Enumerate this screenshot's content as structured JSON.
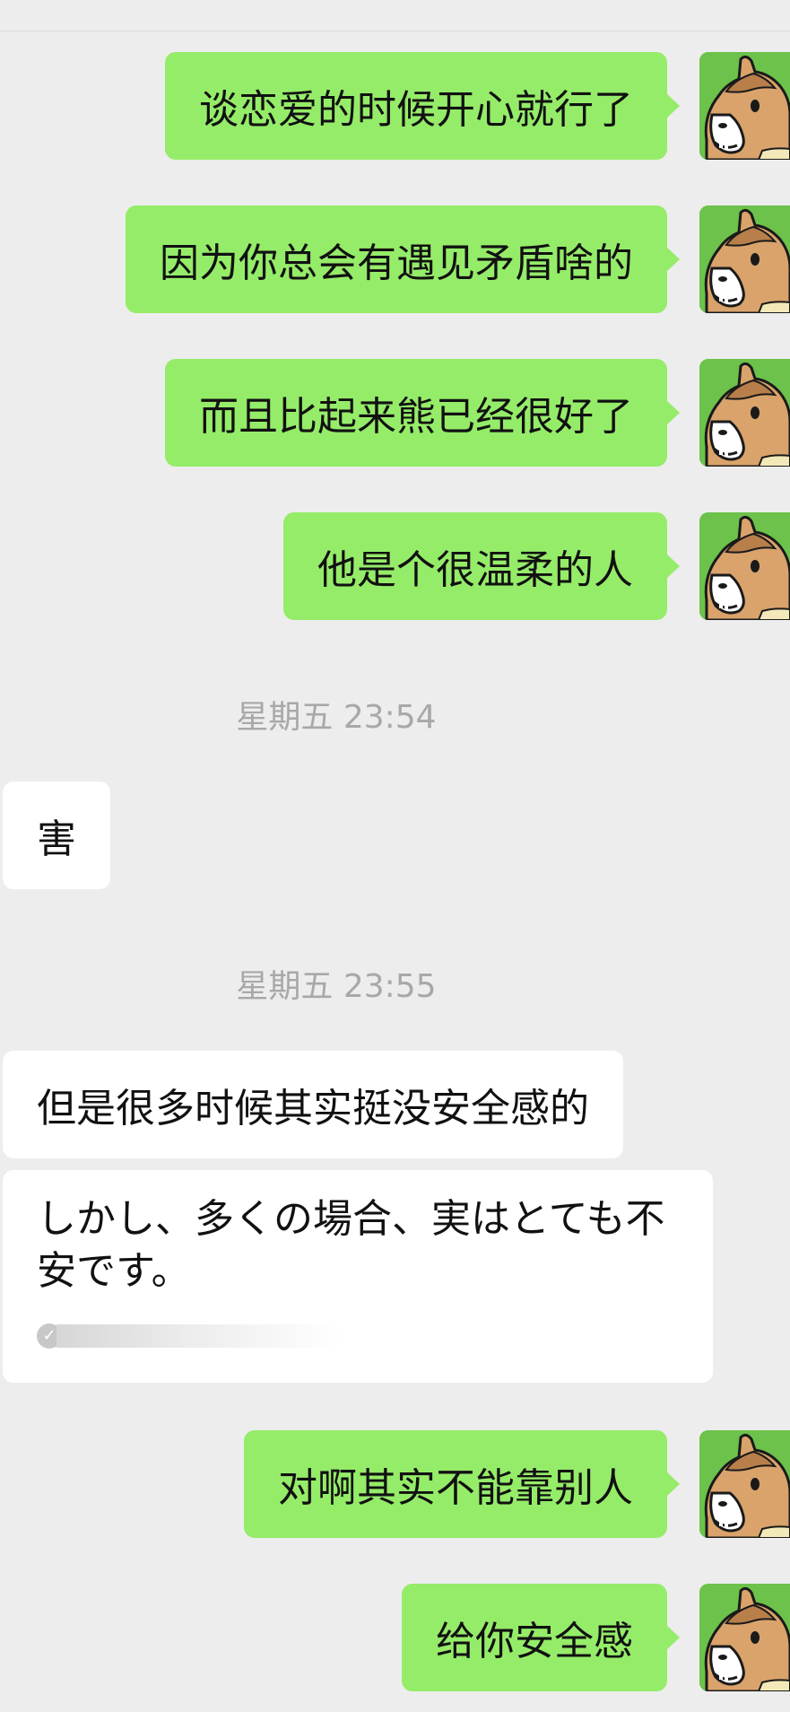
{
  "messages_before": [
    {
      "text": "谈恋爱的时候开心就行了"
    },
    {
      "text": "因为你总会有遇见矛盾啥的"
    },
    {
      "text": "而且比起来熊已经很好了"
    },
    {
      "text": "他是个很温柔的人"
    }
  ],
  "timestamp_1": "星期五 23:54",
  "incoming_1": "害",
  "timestamp_2": "星期五 23:55",
  "incoming_2": "但是很多时候其实挺没安全感的",
  "translation": {
    "text": "しかし、多くの場合、実はとても不安です。",
    "status_icon": "check-icon"
  },
  "messages_after": [
    {
      "text": "对啊其实不能靠别人"
    },
    {
      "text": "给你安全感"
    }
  ],
  "colors": {
    "background": "#ededed",
    "outgoing_bubble": "#95ec69",
    "incoming_bubble": "#ffffff",
    "timestamp_text": "#a8a8a8"
  },
  "avatar": {
    "icon": "horse-head-avatar-icon"
  }
}
